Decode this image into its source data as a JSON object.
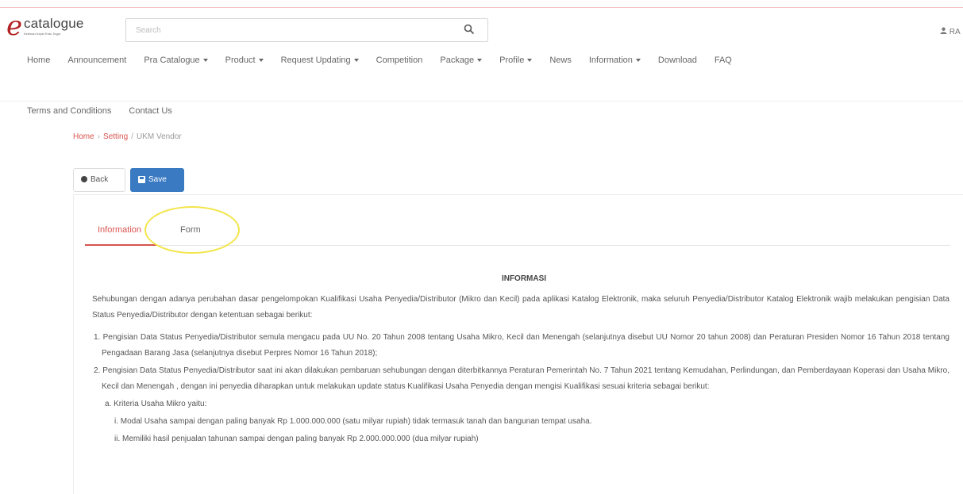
{
  "header": {
    "logo_text": "catalogue",
    "logo_sub": "Kebinan Kepel Entu Tegut",
    "search_placeholder": "Search",
    "user_label": "RA"
  },
  "nav": {
    "row1": [
      {
        "label": "Home",
        "dropdown": false
      },
      {
        "label": "Announcement",
        "dropdown": false
      },
      {
        "label": "Pra Catalogue",
        "dropdown": true
      },
      {
        "label": "Product",
        "dropdown": true
      },
      {
        "label": "Request Updating",
        "dropdown": true
      },
      {
        "label": "Competition",
        "dropdown": false
      },
      {
        "label": "Package",
        "dropdown": true
      },
      {
        "label": "Profile",
        "dropdown": true
      },
      {
        "label": "News",
        "dropdown": false
      },
      {
        "label": "Information",
        "dropdown": true
      },
      {
        "label": "Download",
        "dropdown": false
      },
      {
        "label": "FAQ",
        "dropdown": false
      }
    ],
    "row2": [
      {
        "label": "Terms and Conditions",
        "dropdown": false
      },
      {
        "label": "Contact Us",
        "dropdown": false
      }
    ]
  },
  "breadcrumb": {
    "home": "Home",
    "setting": "Setting",
    "current": "UKM Vendor"
  },
  "toolbar": {
    "back_label": "Back",
    "save_label": "Save"
  },
  "tabs": {
    "information": "Information",
    "form": "Form"
  },
  "content": {
    "heading": "INFORMASI",
    "intro": "Sehubungan dengan adanya perubahan dasar pengelompokan Kualifikasi Usaha Penyedia/Distributor (Mikro dan Kecil) pada aplikasi Katalog Elektronik, maka seluruh Penyedia/Distributor Katalog Elektronik wajib melakukan pengisian Data Status Penyedia/Distributor dengan ketentuan sebagai berikut:",
    "item1": "1. Pengisian Data Status Penyedia/Distributor semula mengacu pada UU No. 20 Tahun 2008 tentang Usaha Mikro, Kecil dan Menengah (selanjutnya disebut UU Nomor 20 tahun 2008) dan Peraturan Presiden Nomor 16 Tahun 2018 tentang Pengadaan Barang Jasa (selanjutnya disebut Perpres Nomor 16 Tahun 2018);",
    "item2": "2. Pengisian Data Status Penyedia/Distributor saat ini akan dilakukan pembaruan sehubungan dengan diterbitkannya Peraturan Pemerintah No. 7 Tahun 2021 tentang Kemudahan, Perlindungan, dan Pemberdayaan Koperasi dan Usaha Mikro, Kecil dan Menengah , dengan ini penyedia diharapkan untuk melakukan update status Kualifikasi Usaha Penyedia dengan mengisi Kualifikasi sesuai kriteria sebagai berikut:",
    "item2a": "a. Kriteria Usaha Mikro yaitu:",
    "item2a_i": "i. Modal Usaha sampai dengan paling banyak Rp 1.000.000.000 (satu milyar rupiah) tidak termasuk tanah dan bangunan tempat usaha.",
    "item2a_ii": "ii. Memiliki hasil penjualan tahunan sampai dengan paling banyak Rp 2.000.000.000 (dua milyar rupiah)"
  },
  "colors": {
    "accent": "#d9534f",
    "primary": "#3a7ac2",
    "highlight": "#f2e54a"
  }
}
